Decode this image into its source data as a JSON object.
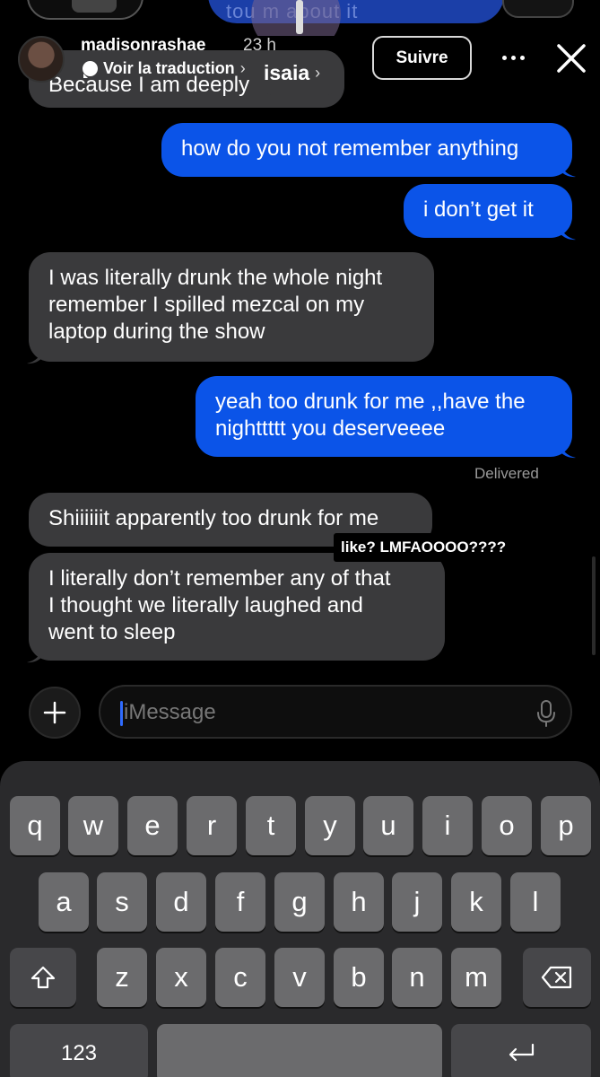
{
  "header": {
    "username": "madisonrashae",
    "time": "23 h",
    "translate": "Voir la traduction",
    "follow_label": "Suivre"
  },
  "top_ghost": {
    "text": "tou    m about it"
  },
  "messages": [
    {
      "dir": "in",
      "text": "Because I am deeply"
    },
    {
      "dir": "out",
      "text": "how do you not remember anything"
    },
    {
      "dir": "out",
      "text": "i don’t get it"
    },
    {
      "dir": "in",
      "lines": [
        "I was literally drunk the whole night",
        "remember I spilled mezcal on my",
        "laptop during the show"
      ]
    },
    {
      "dir": "out",
      "lines": [
        "yeah too drunk for me ,,have the",
        "nighttttt you deserveeee"
      ]
    },
    {
      "dir": "in",
      "text": "Shiiiiiit apparently too drunk for me"
    },
    {
      "dir": "in",
      "lines": [
        "I literally don’t remember any of that",
        "I thought we literally laughed and",
        "went to sleep"
      ]
    }
  ],
  "reply_label": "isaia",
  "delivered": "Delivered",
  "sticker_text": "like? LMFAOOOO????",
  "input": {
    "placeholder": "iMessage"
  },
  "keyboard": {
    "row1": [
      "q",
      "w",
      "e",
      "r",
      "t",
      "y",
      "u",
      "i",
      "o",
      "p"
    ],
    "row2": [
      "a",
      "s",
      "d",
      "f",
      "g",
      "h",
      "j",
      "k",
      "l"
    ],
    "row3": [
      "z",
      "x",
      "c",
      "v",
      "b",
      "n",
      "m"
    ],
    "numbers_label": "123"
  },
  "colors": {
    "outgoing": "#0b54e8",
    "incoming": "#3a3a3c",
    "background": "#000000"
  }
}
